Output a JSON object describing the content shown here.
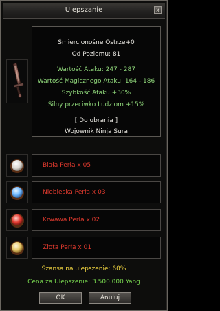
{
  "window": {
    "title": "Ulepszanie",
    "close_glyph": "x"
  },
  "item": {
    "icon": "sword-icon",
    "name": "Śmiercionośne Ostrze+0",
    "level": "Od Poziomu: 81",
    "stats": [
      "Wartość Ataku: 247 - 287",
      "Wartość Magicznego Ataku: 164 - 186",
      "Szybkość Ataku +30%",
      "Silny przeciwko Ludziom +15%"
    ],
    "equip_tag": "[ Do ubrania ]",
    "classes": "Wojownik Ninja Sura"
  },
  "materials": [
    {
      "label": "Biała Perła x 05",
      "icon": "white-pearl-icon",
      "color": "#e9e6e2"
    },
    {
      "label": "Niebieska Perła x 03",
      "icon": "blue-pearl-icon",
      "color": "#6fb8ff"
    },
    {
      "label": "Krwawa Perła x 02",
      "icon": "blood-pearl-icon",
      "color": "#e23a30"
    },
    {
      "label": "Złota Perła x 01",
      "icon": "gold-pearl-icon",
      "color": "#e8c868"
    }
  ],
  "chance": "Szansa na ulepszenie: 60%",
  "cost": "Cena za Ulepszenie: 3.500.000 Yang",
  "buttons": {
    "ok": "OK",
    "cancel": "Anuluj"
  },
  "colors": {
    "stat_green": "#8fd67a",
    "material_red": "#e03a2e",
    "chance_yellow": "#f0d440",
    "cost_green": "#76d34e"
  }
}
